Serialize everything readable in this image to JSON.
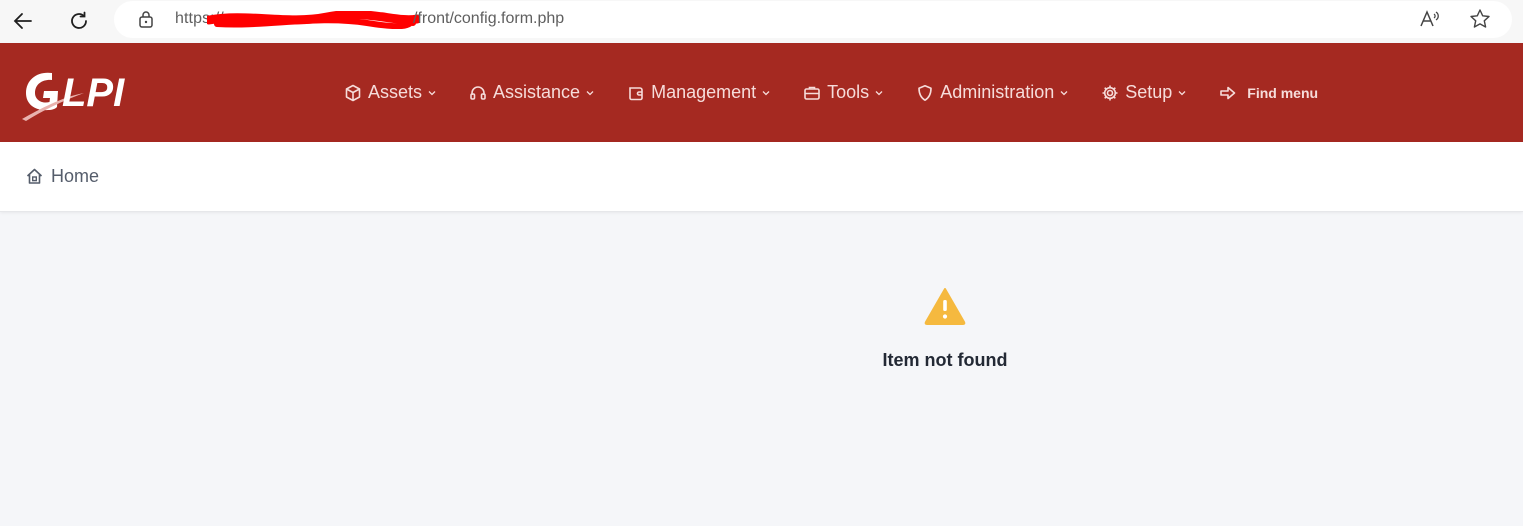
{
  "browser": {
    "url_prefix": "https://",
    "url_path": "/front/config.form.php",
    "icons": [
      "back-arrow-icon",
      "reload-icon",
      "lock-icon",
      "read-aloud-icon",
      "favorite-star-icon"
    ]
  },
  "header": {
    "logo_text": "GLPI",
    "menu": [
      {
        "label": "Assets",
        "icon": "cube-icon"
      },
      {
        "label": "Assistance",
        "icon": "headset-icon"
      },
      {
        "label": "Management",
        "icon": "wallet-icon"
      },
      {
        "label": "Tools",
        "icon": "briefcase-icon"
      },
      {
        "label": "Administration",
        "icon": "shield-icon"
      },
      {
        "label": "Setup",
        "icon": "gear-icon"
      }
    ],
    "find_menu": {
      "label": "Find menu",
      "icon": "arrow-right-icon"
    }
  },
  "breadcrumb": {
    "home": "Home"
  },
  "main": {
    "message": "Item not found"
  },
  "colors": {
    "header_bg": "#a52921",
    "menu_text": "#f6dcda",
    "warning": "#f5b93f"
  }
}
